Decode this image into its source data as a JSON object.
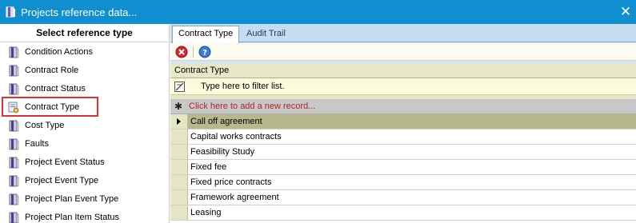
{
  "window": {
    "title": "Projects reference data..."
  },
  "left_panel": {
    "header": "Select reference type",
    "items": [
      {
        "label": "Condition Actions"
      },
      {
        "label": "Contract Role"
      },
      {
        "label": "Contract Status"
      },
      {
        "label": "Contract Type"
      },
      {
        "label": "Cost Type"
      },
      {
        "label": "Faults"
      },
      {
        "label": "Project Event Status"
      },
      {
        "label": "Project Event Type"
      },
      {
        "label": "Project Plan Event Type"
      },
      {
        "label": "Project Plan Item Status"
      }
    ],
    "selected": "Contract Type"
  },
  "tabs": [
    {
      "label": "Contract Type"
    },
    {
      "label": "Audit Trail"
    }
  ],
  "grid": {
    "column_header": "Contract Type",
    "filter_placeholder": "Type here to filter list.",
    "add_record_text": "Click here to add a new record...",
    "rows": [
      "Call off agreement",
      "Capital works contracts",
      "Feasibility Study",
      "Fixed fee",
      "Fixed price contracts",
      "Framework agreement",
      "Leasing"
    ]
  },
  "colors": {
    "titlebar": "#0f8fd0",
    "selection_outline": "#e03030",
    "add_record_text": "#b0242a",
    "current_row": "#b6b98c"
  },
  "icons": {
    "app": "book-icon",
    "item": "book-icon",
    "selected_item": "gear-document-icon",
    "delete": "delete-icon",
    "help": "help-icon",
    "close": "close-icon",
    "filter": "filter-icon",
    "new_record": "asterisk-icon",
    "row_pointer": "row-pointer-icon"
  }
}
